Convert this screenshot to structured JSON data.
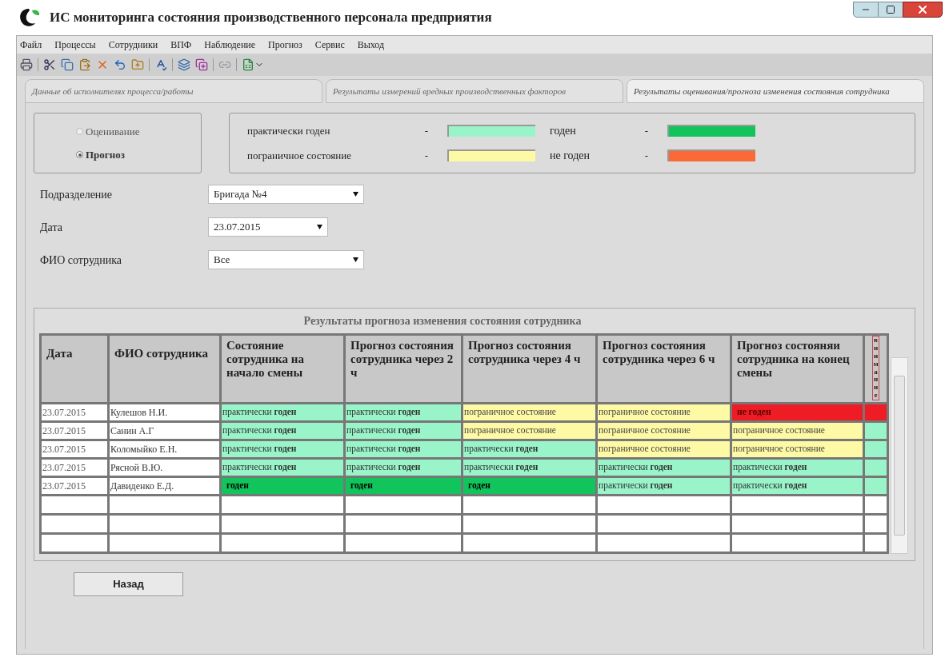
{
  "window": {
    "title": "ИС мониторинга  состояния производственного персонала предприятия"
  },
  "menu": [
    "Файл",
    "Процессы",
    "Сотрудники",
    "ВПФ",
    "Наблюдение",
    "Прогноз",
    "Сервис",
    "Выход"
  ],
  "tabs": [
    {
      "label": "Данные об исполнителях процесса/работы",
      "selected": false
    },
    {
      "label": "Результаты измерений вредных производственных факторов",
      "selected": false
    },
    {
      "label": "Результаты оценивания/прогноза изменения состояния сотрудника",
      "selected": true
    }
  ],
  "mode": [
    {
      "label": "Оценивание",
      "selected": false
    },
    {
      "label": "Прогноз",
      "selected": true
    }
  ],
  "legend": [
    {
      "label": "практически годен",
      "dash": "-",
      "color": "#99f5c9"
    },
    {
      "label": "годен",
      "dash": "-",
      "color": "#11c45c"
    },
    {
      "label": "пограничное состояние",
      "dash": "-",
      "color": "#fdf9a4"
    },
    {
      "label": "не годен",
      "dash": "-",
      "color": "#fb6a36"
    }
  ],
  "filters": [
    {
      "label": "Подразделение",
      "value": "Бригада №4"
    },
    {
      "label": "Дата",
      "value": "23.07.2015"
    },
    {
      "label": "ФИО сотрудника",
      "value": "Все"
    }
  ],
  "table": {
    "title": "Результаты  прогноза изменения состояния сотрудника",
    "columns": [
      "Дата",
      "ФИО сотрудника",
      "Состояние сотрудника на начало смены",
      "Прогноз состояния сотрудника через 2 ч",
      "Прогноз состояния сотрудника через 4 ч",
      "Прогноз состояния сотрудника через 6 ч",
      "Прогноз состояняи сотрудника на конец смены",
      "внимание"
    ],
    "rows": [
      {
        "attention": true,
        "cells": [
          {
            "text": "23.07.2015",
            "kind": "text"
          },
          {
            "text": "Кулешов Н.И.",
            "kind": "text"
          },
          {
            "text": "практически **годен**",
            "kind": "practically_fit"
          },
          {
            "text": "практически **годен**",
            "kind": "practically_fit"
          },
          {
            "text": "пограничное состояние",
            "kind": "borderline"
          },
          {
            "text": "пограничное состояние",
            "kind": "borderline"
          },
          {
            "text": "не годен",
            "kind": "unfit"
          }
        ]
      },
      {
        "attention": false,
        "cells": [
          {
            "text": "23.07.2015",
            "kind": "text"
          },
          {
            "text": "Санин А.Г",
            "kind": "text"
          },
          {
            "text": "практически **годен**",
            "kind": "practically_fit"
          },
          {
            "text": "практически **годен**",
            "kind": "practically_fit"
          },
          {
            "text": "пограничное состояние",
            "kind": "borderline"
          },
          {
            "text": "пограничное состояние",
            "kind": "borderline"
          },
          {
            "text": "пограничное состояние",
            "kind": "borderline"
          }
        ]
      },
      {
        "attention": false,
        "cells": [
          {
            "text": "23.07.2015",
            "kind": "text"
          },
          {
            "text": "Коломыйко Е.Н.",
            "kind": "text"
          },
          {
            "text": "практически **годен**",
            "kind": "practically_fit"
          },
          {
            "text": "практически **годен**",
            "kind": "practically_fit"
          },
          {
            "text": "практически **годен**",
            "kind": "practically_fit"
          },
          {
            "text": "пограничное состояние",
            "kind": "borderline"
          },
          {
            "text": "пограничное состояние",
            "kind": "borderline"
          }
        ]
      },
      {
        "attention": false,
        "cells": [
          {
            "text": "23.07.2015",
            "kind": "text"
          },
          {
            "text": "Рясной В.Ю.",
            "kind": "text"
          },
          {
            "text": "практически **годен**",
            "kind": "practically_fit"
          },
          {
            "text": "практически **годен**",
            "kind": "practically_fit"
          },
          {
            "text": "практически **годен**",
            "kind": "practically_fit"
          },
          {
            "text": "практически **годен**",
            "kind": "practically_fit"
          },
          {
            "text": "практически **годен**",
            "kind": "practically_fit"
          }
        ]
      },
      {
        "attention": false,
        "cells": [
          {
            "text": "23.07.2015",
            "kind": "text"
          },
          {
            "text": "Давиденко Е.Д.",
            "kind": "text"
          },
          {
            "text": "годен",
            "kind": "fit"
          },
          {
            "text": "годен",
            "kind": "fit"
          },
          {
            "text": "годен",
            "kind": "fit"
          },
          {
            "text": "практически **годен**",
            "kind": "practically_fit"
          },
          {
            "text": "практически **годен**",
            "kind": "practically_fit"
          }
        ]
      }
    ]
  },
  "back_button": "Назад"
}
